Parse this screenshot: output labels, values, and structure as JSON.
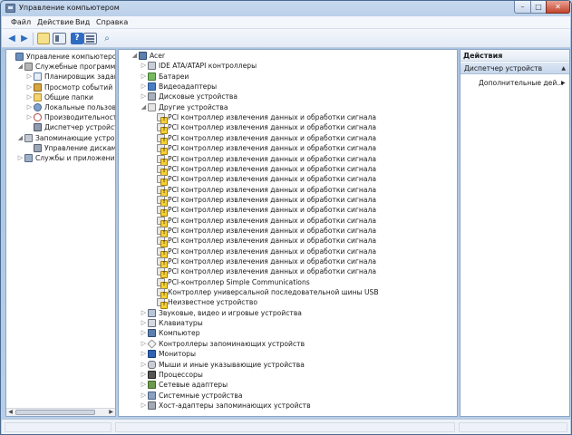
{
  "window": {
    "title": "Управление компьютером",
    "controls": {
      "minimize": "–",
      "maximize": "□",
      "close": "✕"
    }
  },
  "menu": [
    "Файл",
    "Действие",
    "Вид",
    "Справка"
  ],
  "toolbar": {
    "icons": [
      "back-arrow-icon",
      "forward-arrow-icon",
      "up-level-icon",
      "show-hide-tree-icon",
      "help-icon",
      "properties-icon",
      "scan-hardware-icon"
    ],
    "glyphs": {
      "back": "◀",
      "forward": "▶",
      "help": "?",
      "scan": "⌕"
    }
  },
  "left_tree": [
    {
      "label": "Управление компьютером (л",
      "icon": "computer",
      "expander": "",
      "level": 0
    },
    {
      "label": "Служебные программы",
      "icon": "tools",
      "expander": "◢",
      "level": 1
    },
    {
      "label": "Планировщик заданий",
      "icon": "scheduler",
      "expander": "▷",
      "level": 2
    },
    {
      "label": "Просмотр событий",
      "icon": "events",
      "expander": "▷",
      "level": 2
    },
    {
      "label": "Общие папки",
      "icon": "folder",
      "expander": "▷",
      "level": 2
    },
    {
      "label": "Локальные пользовате",
      "icon": "users",
      "expander": "▷",
      "level": 2
    },
    {
      "label": "Производительность",
      "icon": "perf",
      "expander": "▷",
      "level": 2
    },
    {
      "label": "Диспетчер устройств",
      "icon": "devmgr",
      "expander": "",
      "level": 2
    },
    {
      "label": "Запоминающие устройст",
      "icon": "storage",
      "expander": "◢",
      "level": 1
    },
    {
      "label": "Управление дисками",
      "icon": "disk",
      "expander": "",
      "level": 2
    },
    {
      "label": "Службы и приложения",
      "icon": "services",
      "expander": "▷",
      "level": 1
    }
  ],
  "device_tree": [
    {
      "label": "Acer",
      "icon": "pc",
      "expander": "◢",
      "level": 0
    },
    {
      "label": "IDE ATA/ATAPI контроллеры",
      "icon": "drive",
      "expander": "▷",
      "level": 1
    },
    {
      "label": "Батареи",
      "icon": "battery",
      "expander": "▷",
      "level": 1
    },
    {
      "label": "Видеоадаптеры",
      "icon": "display",
      "expander": "▷",
      "level": 1
    },
    {
      "label": "Дисковые устройства",
      "icon": "diskdrive",
      "expander": "▷",
      "level": 1
    },
    {
      "label": "Другие устройства",
      "icon": "unknown",
      "expander": "◢",
      "level": 1
    },
    {
      "label": "PCI контроллер извлечения данных и обработки сигнала",
      "icon": "warn",
      "expander": "",
      "level": 2
    },
    {
      "label": "PCI контроллер извлечения данных и обработки сигнала",
      "icon": "warn",
      "expander": "",
      "level": 2
    },
    {
      "label": "PCI контроллер извлечения данных и обработки сигнала",
      "icon": "warn",
      "expander": "",
      "level": 2
    },
    {
      "label": "PCI контроллер извлечения данных и обработки сигнала",
      "icon": "warn",
      "expander": "",
      "level": 2
    },
    {
      "label": "PCI контроллер извлечения данных и обработки сигнала",
      "icon": "warn",
      "expander": "",
      "level": 2
    },
    {
      "label": "PCI контроллер извлечения данных и обработки сигнала",
      "icon": "warn",
      "expander": "",
      "level": 2
    },
    {
      "label": "PCI контроллер извлечения данных и обработки сигнала",
      "icon": "warn",
      "expander": "",
      "level": 2
    },
    {
      "label": "PCI контроллер извлечения данных и обработки сигнала",
      "icon": "warn",
      "expander": "",
      "level": 2
    },
    {
      "label": "PCI контроллер извлечения данных и обработки сигнала",
      "icon": "warn",
      "expander": "",
      "level": 2
    },
    {
      "label": "PCI контроллер извлечения данных и обработки сигнала",
      "icon": "warn",
      "expander": "",
      "level": 2
    },
    {
      "label": "PCI контроллер извлечения данных и обработки сигнала",
      "icon": "warn",
      "expander": "",
      "level": 2
    },
    {
      "label": "PCI контроллер извлечения данных и обработки сигнала",
      "icon": "warn",
      "expander": "",
      "level": 2
    },
    {
      "label": "PCI контроллер извлечения данных и обработки сигнала",
      "icon": "warn",
      "expander": "",
      "level": 2
    },
    {
      "label": "PCI контроллер извлечения данных и обработки сигнала",
      "icon": "warn",
      "expander": "",
      "level": 2
    },
    {
      "label": "PCI контроллер извлечения данных и обработки сигнала",
      "icon": "warn",
      "expander": "",
      "level": 2
    },
    {
      "label": "PCI контроллер извлечения данных и обработки сигнала",
      "icon": "warn",
      "expander": "",
      "level": 2
    },
    {
      "label": "PCI-контроллер Simple Communications",
      "icon": "warn",
      "expander": "",
      "level": 2
    },
    {
      "label": "Контроллер универсальной последовательной шины USB",
      "icon": "warn",
      "expander": "",
      "level": 2
    },
    {
      "label": "Неизвестное устройство",
      "icon": "warn",
      "expander": "",
      "level": 2
    },
    {
      "label": "Звуковые, видео и игровые устройства",
      "icon": "sound",
      "expander": "▷",
      "level": 1
    },
    {
      "label": "Клавиатуры",
      "icon": "keyboard",
      "expander": "▷",
      "level": 1
    },
    {
      "label": "Компьютер",
      "icon": "pc",
      "expander": "▷",
      "level": 1
    },
    {
      "label": "Контроллеры запоминающих устройств",
      "icon": "controller",
      "expander": "▷",
      "level": 1
    },
    {
      "label": "Мониторы",
      "icon": "monitor",
      "expander": "▷",
      "level": 1
    },
    {
      "label": "Мыши и иные указывающие устройства",
      "icon": "mouse",
      "expander": "▷",
      "level": 1
    },
    {
      "label": "Процессоры",
      "icon": "cpu",
      "expander": "▷",
      "level": 1
    },
    {
      "label": "Сетевые адаптеры",
      "icon": "network",
      "expander": "▷",
      "level": 1
    },
    {
      "label": "Системные устройства",
      "icon": "system",
      "expander": "▷",
      "level": 1
    },
    {
      "label": "Хост-адаптеры запоминающих устройств",
      "icon": "hostadapter",
      "expander": "▷",
      "level": 1
    }
  ],
  "actions": {
    "header": "Действия",
    "section": "Диспетчер устройств",
    "section_caret": "▲",
    "more": "Дополнительные дей...",
    "more_caret": "▶"
  },
  "left_scroll": {
    "left": "◀",
    "right": "▶"
  }
}
